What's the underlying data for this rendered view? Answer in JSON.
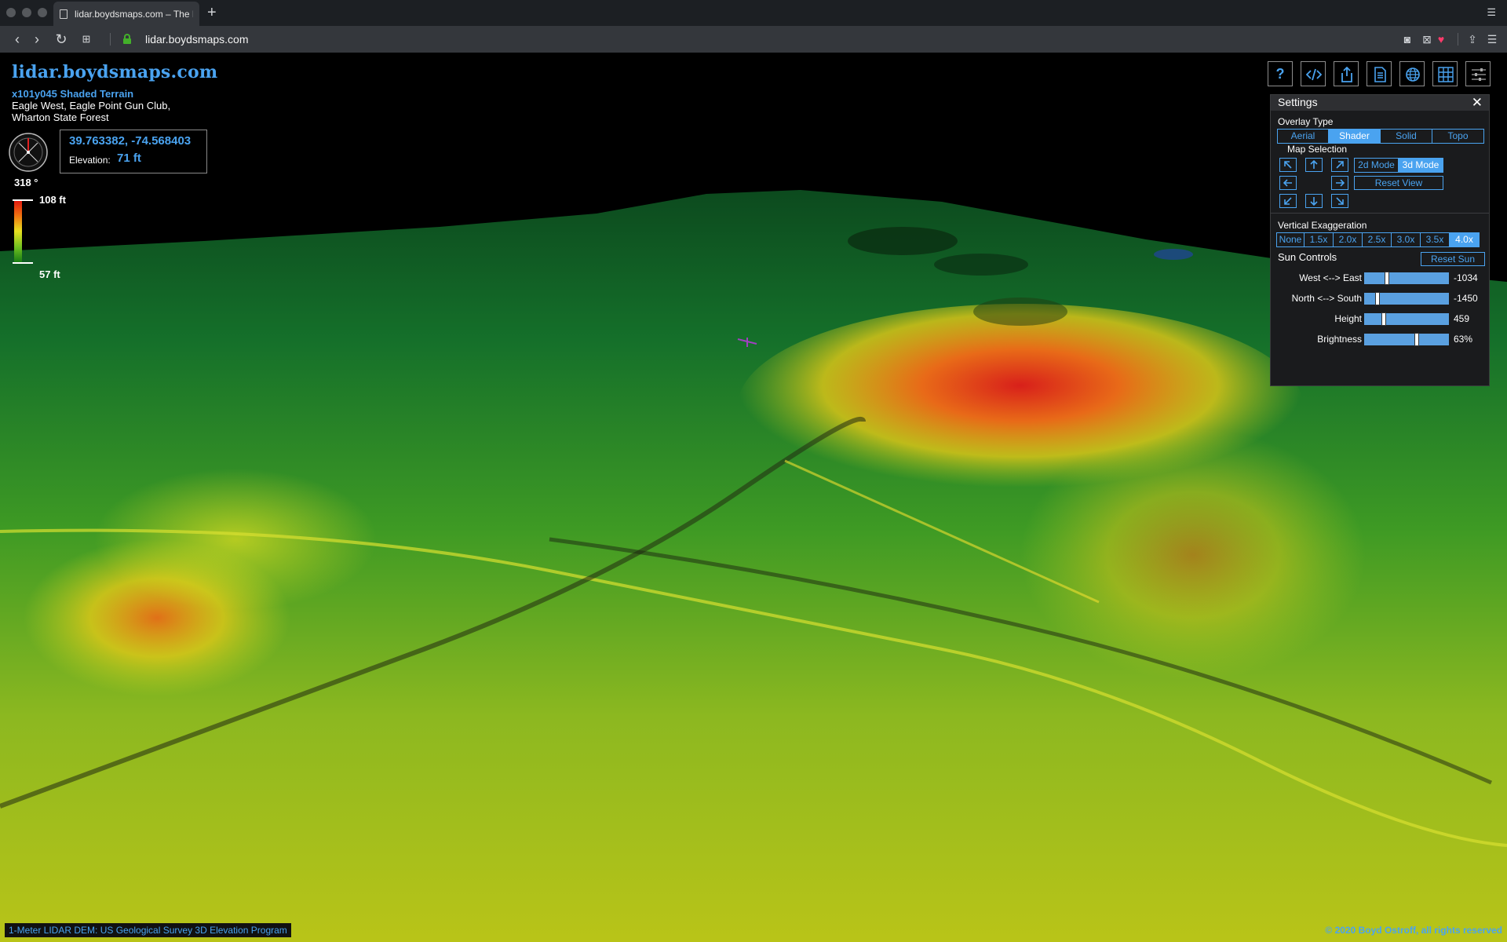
{
  "browser": {
    "tab_title": "lidar.boydsmaps.com – The N",
    "new_tab": "+",
    "url": "lidar.boydsmaps.com",
    "tab_list_icon": "tab-list-icon"
  },
  "map": {
    "site_title": "lidar.boydsmaps.com",
    "tile_name": "x101y045 Shaded Terrain",
    "location_lines": [
      "Eagle West, Eagle Point Gun Club,",
      "Wharton State Forest"
    ],
    "heading": "318 °",
    "coordinates": "39.763382, -74.568403",
    "elevation_label": "Elevation:",
    "elevation_value": "71 ft",
    "legend": {
      "max_label": "108 ft",
      "min_label": "57 ft"
    },
    "toolbar_icons": [
      "help-icon",
      "embed-code-icon",
      "share-icon",
      "document-icon",
      "globe-icon",
      "grid-icon",
      "settings-sliders-icon"
    ],
    "help_label": "?",
    "attribution_left": "1-Meter LIDAR DEM: US Geological Survey 3D Elevation Program",
    "attribution_right": "© 2020 Boyd Ostroff, all rights reserved"
  },
  "settings": {
    "title": "Settings",
    "close_label": "✕",
    "overlay_type_label": "Overlay Type",
    "overlay_types": [
      "Aerial",
      "Shader",
      "Solid",
      "Topo"
    ],
    "overlay_selected": "Shader",
    "map_selection_label": "Map Selection",
    "mode_options": [
      "2d Mode",
      "3d Mode"
    ],
    "mode_selected": "3d Mode",
    "reset_view_label": "Reset View",
    "vertical_exaggeration_label": "Vertical Exaggeration",
    "exaggeration_options": [
      "None",
      "1.5x",
      "2.0x",
      "2.5x",
      "3.0x",
      "3.5x",
      "4.0x"
    ],
    "exaggeration_selected": "4.0x",
    "sun_controls_label": "Sun Controls",
    "reset_sun_label": "Reset Sun",
    "sliders": [
      {
        "label": "West <--> East",
        "value": "-1034",
        "fraction": 0.25
      },
      {
        "label": "North <--> South",
        "value": "-1450",
        "fraction": 0.14
      },
      {
        "label": "Height",
        "value": "459",
        "fraction": 0.22
      },
      {
        "label": "Brightness",
        "value": "63%",
        "fraction": 0.63
      }
    ]
  },
  "colors": {
    "accent": "#4aa3f0",
    "terrain_high": "#e01010",
    "terrain_mid": "#e8e020",
    "terrain_low": "#147a14"
  }
}
